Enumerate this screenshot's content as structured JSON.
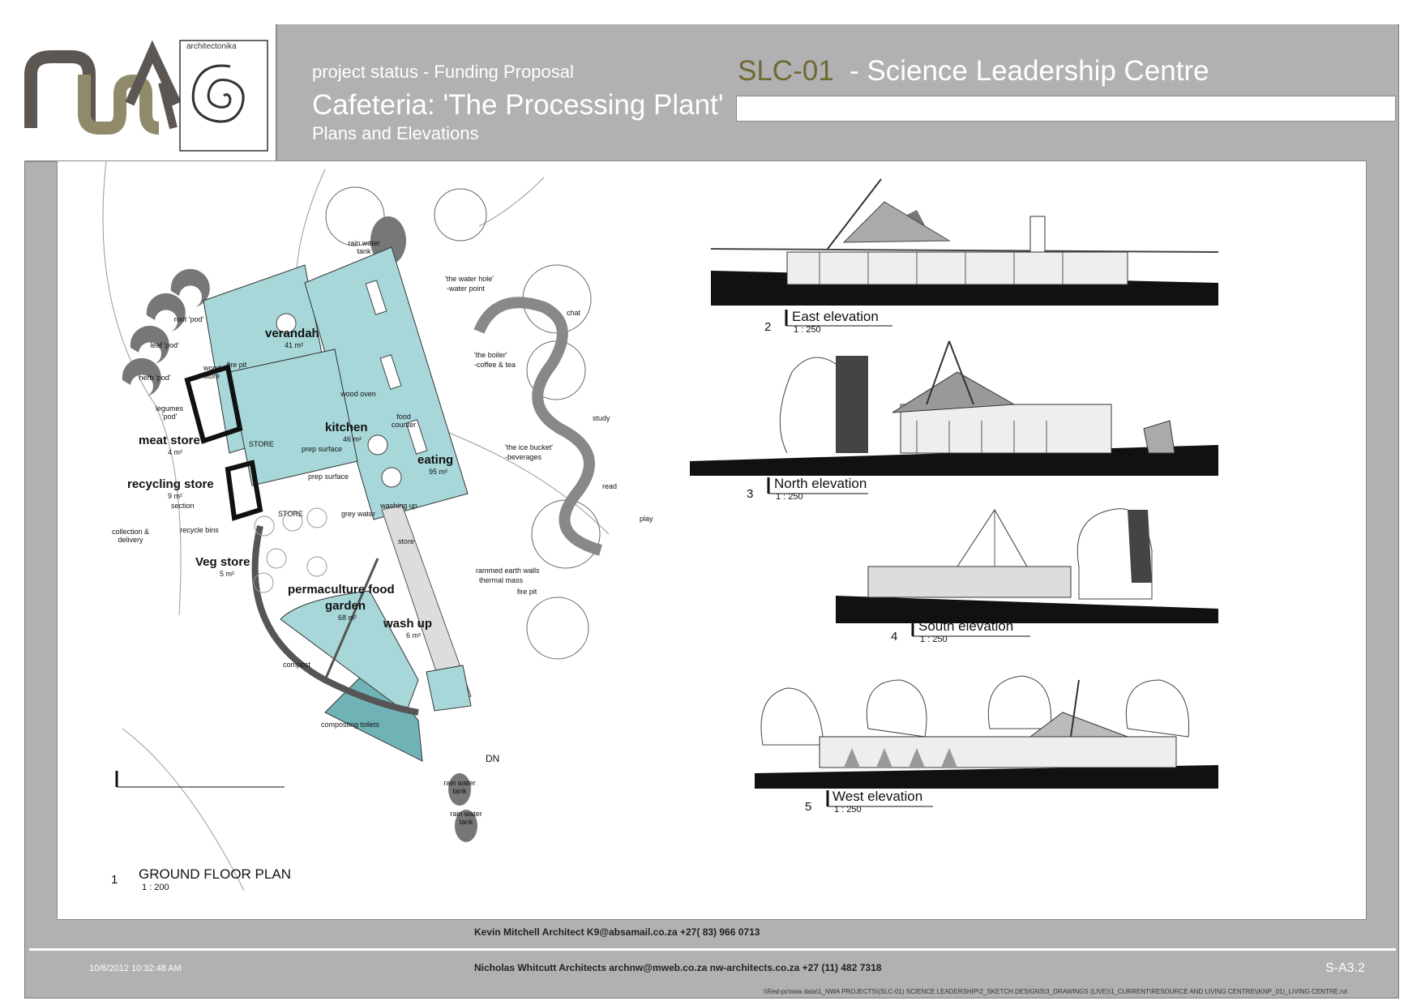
{
  "header": {
    "project_status": "project status - Funding Proposal",
    "title": "Cafeteria: 'The Processing Plant'",
    "subtitle": "Plans and Elevations",
    "project_code": "SLC-01",
    "project_name": "- Science Leadership Centre",
    "logo_seal_text": "architectonika"
  },
  "plan": {
    "number": "1",
    "title": "GROUND FLOOR PLAN",
    "scale": "1 : 200",
    "rooms": [
      {
        "name": "verandah",
        "area": "41 m²"
      },
      {
        "name": "kitchen",
        "area": "46 m²"
      },
      {
        "name": "eating",
        "area": "95 m²"
      },
      {
        "name": "meat store",
        "area": "4 m²"
      },
      {
        "name": "recycling store",
        "area": "9 m²"
      },
      {
        "name": "Veg store",
        "area": "5 m²"
      },
      {
        "name": "permaculture food",
        "area": ""
      },
      {
        "name": "garden",
        "area": "68 m²"
      },
      {
        "name": "wash up",
        "area": "6 m²"
      }
    ],
    "labels": {
      "root_pod": "root 'pod'",
      "leaf_pod": "leaf 'pod'",
      "herb_pod": "herb 'pod'",
      "legumes_pod": "legumes 'pod'",
      "wood_store": "wood store",
      "fire_pit": "fire pit",
      "wood_oven": "wood oven",
      "prep_surface_1": "prep surface",
      "prep_surface_2": "prep surface",
      "store_1": "STORE",
      "store_2": "STORE",
      "store_3": "store",
      "food_counter": "food counter",
      "washing_up": "washing up",
      "grey_water": "grey water",
      "compost": "compost",
      "composting_toilets": "composting toilets",
      "rain_water_tank": "rain water tank",
      "water_hole": "'the water hole'",
      "water_point": "-water point",
      "the_boiler": "'the boiler'",
      "coffee_tea": "-coffee & tea",
      "ice_bucket": "'the ice bucket'",
      "beverages": "-beverages",
      "rammed_earth": "rammed earth walls",
      "thermal_mass": "thermal mass",
      "collection": "collection & delivery",
      "recycle_bins": "recycle bins",
      "section": "section",
      "dn": "DN",
      "chat": "chat",
      "study": "study",
      "read": "read",
      "play": "play"
    }
  },
  "elevations": [
    {
      "number": "2",
      "title": "East elevation",
      "scale": "1 : 250"
    },
    {
      "number": "3",
      "title": "North elevation",
      "scale": "1 : 250"
    },
    {
      "number": "4",
      "title": "South elevation",
      "scale": "1 : 250"
    },
    {
      "number": "5",
      "title": "West elevation",
      "scale": "1 : 250"
    }
  ],
  "footer": {
    "contact_1": "Kevin Mitchell Architect K9@absamail.co.za  +27( 83) 966 0713",
    "contact_2": "Nicholas Whitcutt Architects archnw@mweb.co.za nw-architects.co.za +27 (11) 482 7318",
    "timestamp": "10/6/2012 10:32:48 AM",
    "sheet_number": "S-A3.2",
    "file_path": "\\\\Red-pc\\nwa data\\1_NWA PROJECTS\\(SLC-01) SCIENCE LEADERSHIP\\2_SKETCH DESIGNS\\3_DRAWINGS (LIVE)\\1_CURRENT\\RESOURCE AND LIVING CENTRE\\(KNP_01)_LIVING CENTRE.rvt"
  },
  "colors": {
    "sheet_grey": "#b1b1b3",
    "plan_teal": "#a7d7d9",
    "olive": "#6f6a32",
    "logo_dark": "#5d5754",
    "logo_olive": "#8f8b6a"
  }
}
